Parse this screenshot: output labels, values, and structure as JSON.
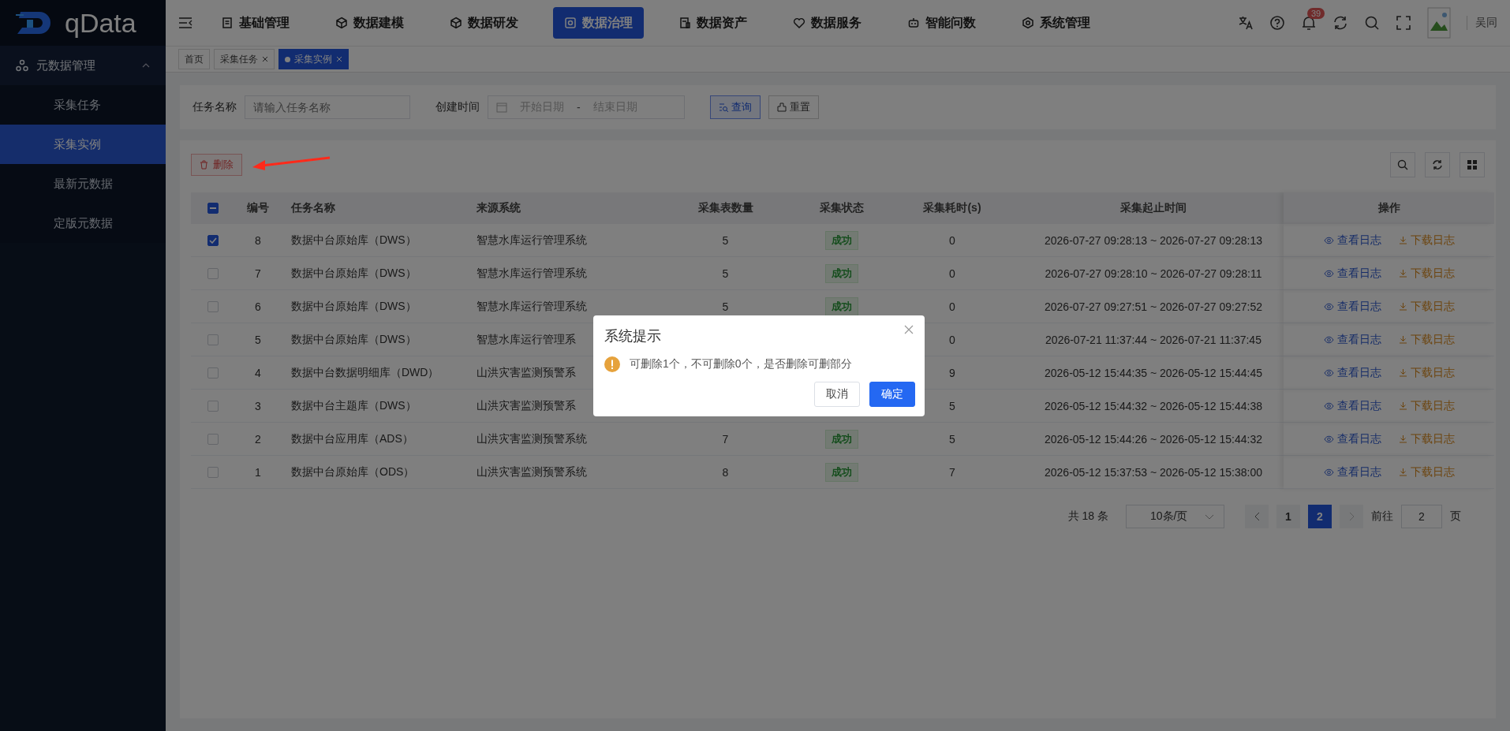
{
  "logo": {
    "text": "qData"
  },
  "sidebar": {
    "groups": [
      {
        "label": "元数据管理",
        "expanded": true,
        "children": [
          {
            "label": "采集任务",
            "selected": false
          },
          {
            "label": "采集实例",
            "selected": true
          },
          {
            "label": "最新元数据",
            "selected": false
          },
          {
            "label": "定版元数据",
            "selected": false
          }
        ]
      }
    ]
  },
  "nav": [
    {
      "label": "基础管理",
      "selected": false
    },
    {
      "label": "数据建模",
      "selected": false
    },
    {
      "label": "数据研发",
      "selected": false
    },
    {
      "label": "数据治理",
      "selected": true
    },
    {
      "label": "数据资产",
      "selected": false
    },
    {
      "label": "数据服务",
      "selected": false
    },
    {
      "label": "智能问数",
      "selected": false
    },
    {
      "label": "系统管理",
      "selected": false
    }
  ],
  "header": {
    "notification_count": "39",
    "user": "吴同"
  },
  "page_tabs": [
    {
      "label": "首页",
      "selected": false,
      "closable": false
    },
    {
      "label": "采集任务",
      "selected": false,
      "closable": true
    },
    {
      "label": "采集实例",
      "selected": true,
      "closable": true
    }
  ],
  "filters": {
    "task_name": {
      "label": "任务名称",
      "placeholder": "请输入任务名称"
    },
    "created": {
      "label": "创建时间",
      "start_placeholder": "开始日期",
      "separator": "-",
      "end_placeholder": "结束日期"
    },
    "buttons": [
      {
        "label": "查询",
        "kind": "primary"
      },
      {
        "label": "重置",
        "kind": "plain"
      }
    ]
  },
  "toolbar": {
    "delete_label": "删除"
  },
  "table": {
    "all_indeterminate": true,
    "columns": [
      "编号",
      "任务名称",
      "来源系统",
      "采集表数量",
      "采集状态",
      "采集耗时(s)",
      "采集起止时间",
      "操作"
    ],
    "rows": [
      {
        "checked": true,
        "id": "8",
        "name": "数据中台原始库（DWS）",
        "source": "智慧水库运行管理系统",
        "tables": "5",
        "status": "成功",
        "duration": "0",
        "range": "2026-07-27 09:28:13 ~ 2026-07-27 09:28:13",
        "actions": [
          "查看日志",
          "下载日志"
        ]
      },
      {
        "checked": false,
        "id": "7",
        "name": "数据中台原始库（DWS）",
        "source": "智慧水库运行管理系统",
        "tables": "5",
        "status": "成功",
        "duration": "0",
        "range": "2026-07-27 09:28:10 ~ 2026-07-27 09:28:11",
        "actions": [
          "查看日志",
          "下载日志"
        ]
      },
      {
        "checked": false,
        "id": "6",
        "name": "数据中台原始库（DWS）",
        "source": "智慧水库运行管理系统",
        "tables": "5",
        "status": "成功",
        "duration": "0",
        "range": "2026-07-27 09:27:51 ~ 2026-07-27 09:27:52",
        "actions": [
          "查看日志",
          "下载日志"
        ]
      },
      {
        "checked": false,
        "id": "5",
        "name": "数据中台原始库（DWS）",
        "source": "智慧水库运行管理系",
        "duration": "0",
        "range": "2026-07-21 11:37:44 ~ 2026-07-21 11:37:45",
        "actions": [
          "查看日志",
          "下载日志"
        ]
      },
      {
        "checked": false,
        "id": "4",
        "name": "数据中台数据明细库（DWD）",
        "source": "山洪灾害监测预警系",
        "duration": "9",
        "range": "2026-05-12 15:44:35 ~ 2026-05-12 15:44:45",
        "actions": [
          "查看日志",
          "下载日志"
        ]
      },
      {
        "checked": false,
        "id": "3",
        "name": "数据中台主题库（DWS）",
        "source": "山洪灾害监测预警系",
        "duration": "5",
        "range": "2026-05-12 15:44:32 ~ 2026-05-12 15:44:38",
        "actions": [
          "查看日志",
          "下载日志"
        ]
      },
      {
        "checked": false,
        "id": "2",
        "name": "数据中台应用库（ADS）",
        "source": "山洪灾害监测预警系统",
        "tables": "7",
        "status": "成功",
        "duration": "5",
        "range": "2026-05-12 15:44:26 ~ 2026-05-12 15:44:32",
        "actions": [
          "查看日志",
          "下载日志"
        ]
      },
      {
        "checked": false,
        "id": "1",
        "name": "数据中台原始库（ODS）",
        "source": "山洪灾害监测预警系统",
        "tables": "8",
        "status": "成功",
        "duration": "7",
        "range": "2026-05-12 15:37:53 ~ 2026-05-12 15:38:00",
        "actions": [
          "查看日志",
          "下载日志"
        ]
      }
    ]
  },
  "pagination": {
    "total": "共 18 条",
    "page_size": "10条/页",
    "pages": [
      {
        "label": "1",
        "selected": false
      },
      {
        "label": "2",
        "selected": true
      }
    ],
    "jump_label": "前往",
    "jump_value": "2",
    "jump_suffix": "页"
  },
  "dialog": {
    "title": "系统提示",
    "message": "可删除1个，不可删除0个，是否删除可删部分",
    "buttons": [
      {
        "label": "取消",
        "kind": "plain"
      },
      {
        "label": "确定",
        "kind": "primary"
      }
    ]
  }
}
